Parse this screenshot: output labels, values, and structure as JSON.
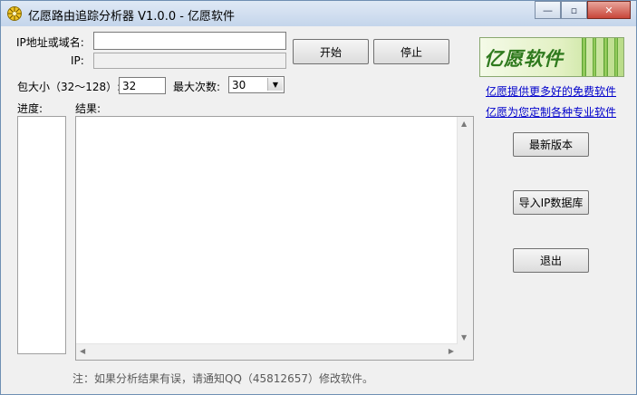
{
  "window": {
    "title": "亿愿路由追踪分析器 V1.0.0 - 亿愿软件",
    "minimize_glyph": "—",
    "maximize_glyph": "▫",
    "close_glyph": "✕"
  },
  "form": {
    "host_label": "IP地址或域名:",
    "host_value": "",
    "ip_label": "IP:",
    "ip_value": "",
    "packet_size_label": "包大小（32～128）:",
    "packet_size_value": "32",
    "max_count_label": "最大次数:",
    "max_count_value": "30"
  },
  "buttons": {
    "start": "开始",
    "stop": "停止",
    "latest_version": "最新版本",
    "import_ip_db": "导入IP数据库",
    "exit": "退出"
  },
  "panels": {
    "progress_label": "进度:",
    "result_label": "结果:"
  },
  "sidebar": {
    "logo_text": "亿愿软件",
    "link_free": "亿愿提供更多好的免费软件",
    "link_custom": "亿愿为您定制各种专业软件"
  },
  "footer": {
    "note": "注：如果分析结果有误，请通知QQ（45812657）修改软件。"
  },
  "icons": [
    "app-icon",
    "minimize-icon",
    "maximize-icon",
    "close-icon",
    "dropdown-arrow-icon",
    "scroll-up-icon",
    "scroll-down-icon",
    "scroll-left-icon",
    "scroll-right-icon"
  ]
}
